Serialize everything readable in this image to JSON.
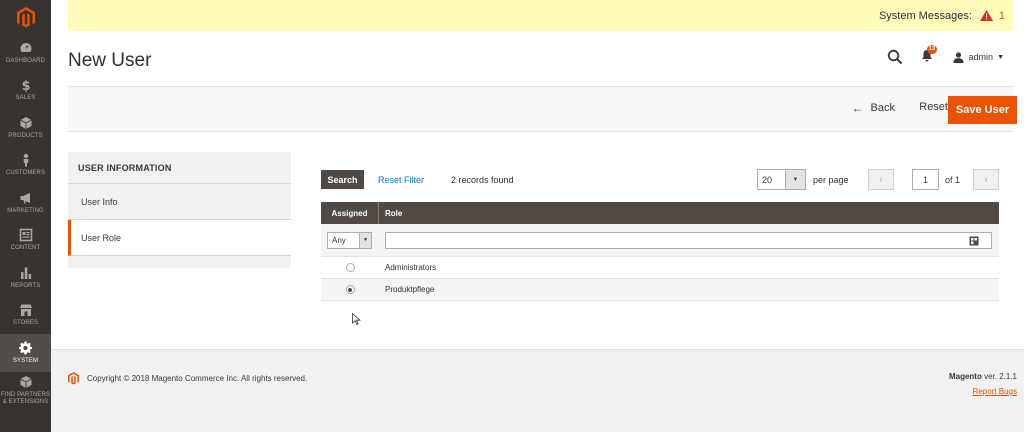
{
  "sidebar": {
    "items": [
      {
        "label": "DASHBOARD",
        "icon": "dashboard-icon"
      },
      {
        "label": "SALES",
        "icon": "dollar-icon"
      },
      {
        "label": "PRODUCTS",
        "icon": "cube-icon"
      },
      {
        "label": "CUSTOMERS",
        "icon": "person-icon"
      },
      {
        "label": "MARKETING",
        "icon": "megaphone-icon"
      },
      {
        "label": "CONTENT",
        "icon": "content-icon"
      },
      {
        "label": "REPORTS",
        "icon": "bar-chart-icon"
      },
      {
        "label": "STORES",
        "icon": "store-icon"
      },
      {
        "label": "SYSTEM",
        "icon": "gear-icon",
        "active": true
      },
      {
        "label_line1": "FIND PARTNERS",
        "label_line2": "& EXTENSIONS",
        "icon": "box-icon"
      }
    ]
  },
  "system_messages": {
    "label": "System Messages:",
    "count": "1"
  },
  "page_title": "New User",
  "header": {
    "notifications_count": "13",
    "user": "admin"
  },
  "actions": {
    "back": "Back",
    "reset": "Reset",
    "save": "Save User"
  },
  "tabs": {
    "header": "USER INFORMATION",
    "items": [
      {
        "label": "User Info",
        "active": false
      },
      {
        "label": "User Role",
        "active": true
      }
    ]
  },
  "grid": {
    "search_button": "Search",
    "reset_filter": "Reset Filter",
    "records_found": "2 records found",
    "per_page_value": "20",
    "per_page_label": "per page",
    "page_value": "1",
    "page_of": "of 1",
    "columns": {
      "assigned": "Assigned",
      "role": "Role"
    },
    "filter_any": "Any",
    "rows": [
      {
        "role": "Administrators",
        "checked": false
      },
      {
        "role": "Produktpflege",
        "checked": true
      }
    ]
  },
  "footer": {
    "copyright": "Copyright © 2018 Magento Commerce Inc. All rights reserved.",
    "brand": "Magento",
    "version": " ver. 2.1.1",
    "report_bugs": "Report Bugs"
  },
  "colors": {
    "accent": "#eb5202",
    "sidebar": "#373330",
    "link": "#007bdb"
  }
}
